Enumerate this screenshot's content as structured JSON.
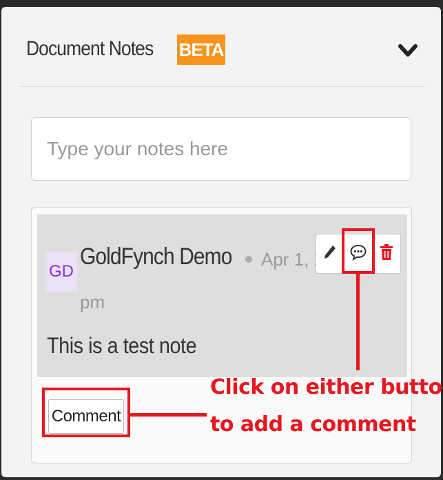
{
  "panel": {
    "title": "Document Notes",
    "badge": "BETA"
  },
  "notes_input": {
    "placeholder": "Type your notes here",
    "value": ""
  },
  "note": {
    "avatar_initials": "GD",
    "author": "GoldFynch Demo",
    "date_visible": "Apr 1, 2",
    "time_suffix": "pm",
    "text": "This is a test note",
    "actions": [
      "edit-icon",
      "comment-icon",
      "trash-icon"
    ],
    "comment_label": "Comment"
  },
  "annotation": {
    "line1": "Click on either button",
    "line2": "to add a comment",
    "color": "#e8161f"
  },
  "colors": {
    "badge": "#f7941d",
    "avatar_text": "#8a2be2",
    "delete": "#e8161f"
  }
}
